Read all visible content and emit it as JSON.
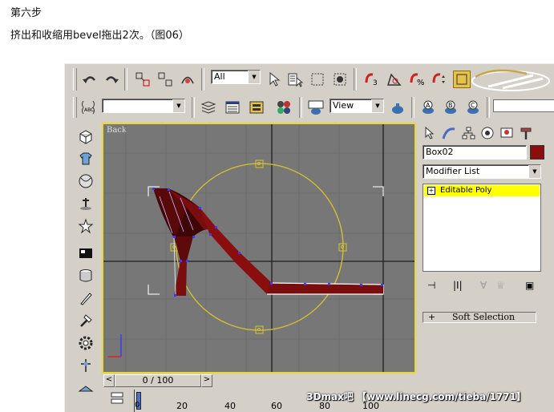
{
  "article": {
    "step_title": "第六步",
    "step_desc": "挤出和收缩用bevel拖出2次。（图06）"
  },
  "toolbar": {
    "filter_value": "All",
    "view_value": "View"
  },
  "viewport": {
    "label": "Back"
  },
  "command_panel": {
    "object_name": "Box02",
    "object_color": "#8b0e0e",
    "modifier_list_label": "Modifier List",
    "stack_item": "Editable Poly",
    "soft_selection_sign": "+",
    "soft_selection_label": "Soft Selection"
  },
  "timeline": {
    "counter": "0 / 100",
    "prev": "<",
    "next": ">",
    "ticks": [
      "0",
      "20",
      "40",
      "60",
      "80",
      "100"
    ]
  },
  "watermark": {
    "text": "3Dmax吧 【www.linecg.com/tieba/1771】"
  },
  "colors": {
    "accent": "#e8d830",
    "model": "#7a0d0d",
    "selection": "#ffff00"
  }
}
